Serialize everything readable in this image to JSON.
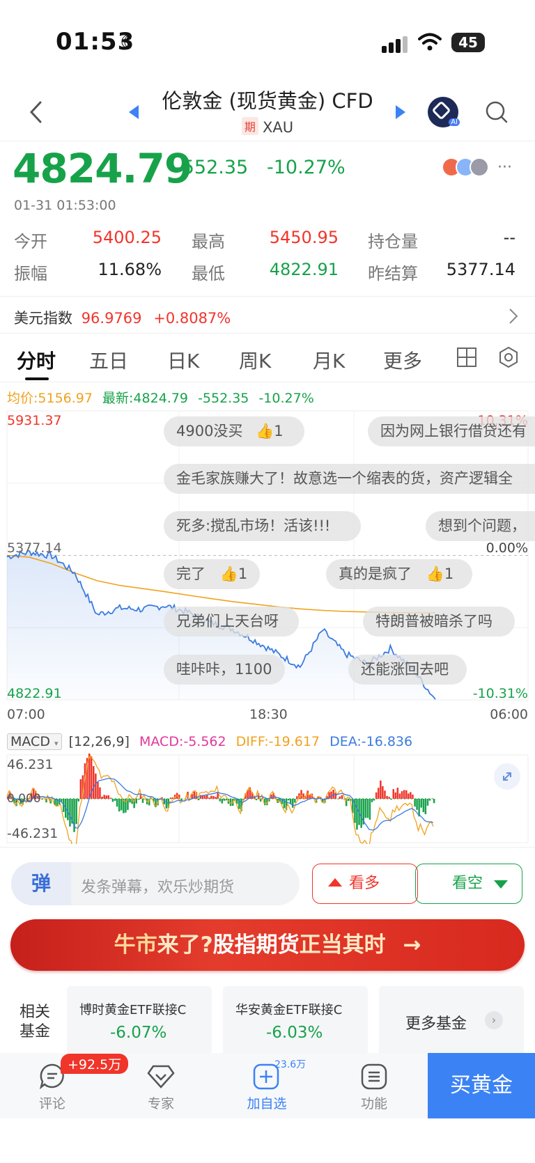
{
  "status_bar": {
    "time": "01:53",
    "battery": "45"
  },
  "header": {
    "title": "伦敦金 (现货黄金) CFD",
    "badge": "期",
    "symbol": "XAU",
    "ai_label": "AI"
  },
  "quote": {
    "price": "4824.79",
    "change": "-552.35",
    "change_pct": "-10.27%",
    "timestamp": "01-31 01:53:00",
    "more": "···",
    "stats": [
      {
        "label": "今开",
        "value": "5400.25",
        "color": "#f0352b"
      },
      {
        "label": "最高",
        "value": "5450.95",
        "color": "#f0352b"
      },
      {
        "label": "持仓量",
        "value": "--",
        "color": "#222222"
      },
      {
        "label": "振幅",
        "value": "11.68%",
        "color": "#222222"
      },
      {
        "label": "最低",
        "value": "4822.91",
        "color": "#17a24a"
      },
      {
        "label": "昨结算",
        "value": "5377.14",
        "color": "#222222"
      }
    ]
  },
  "usd_index": {
    "label": "美元指数",
    "value": "96.9769",
    "change": "+0.8087%"
  },
  "tabs": [
    "分时",
    "五日",
    "日K",
    "周K",
    "月K",
    "更多"
  ],
  "chart": {
    "avg_label": "均价:5156.97",
    "latest_label": "最新:4824.79",
    "latest_change": "-552.35",
    "latest_pct": "-10.27%",
    "y_top": "5931.37",
    "y_mid": "5377.14",
    "y_bottom": "4822.91",
    "pct_top": "10.31%",
    "pct_mid": "0.00%",
    "pct_bottom": "-10.31%",
    "x_labels": [
      "07:00",
      "18:30",
      "06:00"
    ],
    "colors": {
      "price_line": "#3a7be0",
      "avg_line": "#f0a21e"
    }
  },
  "chart_data": {
    "type": "line",
    "x": [
      "07:00",
      "08:00",
      "09:00",
      "10:00",
      "11:00",
      "12:00",
      "13:00",
      "14:00",
      "15:00",
      "16:00",
      "17:00",
      "18:00",
      "19:00",
      "20:00",
      "21:00",
      "22:00",
      "23:00",
      "00:00",
      "01:00",
      "01:53"
    ],
    "series": [
      {
        "name": "最新",
        "values": [
          5372,
          5390,
          5375,
          5310,
          5150,
          5175,
          5170,
          5185,
          5160,
          5120,
          5095,
          5050,
          5000,
          4950,
          5090,
          5000,
          4960,
          5020,
          4940,
          4824.79
        ]
      },
      {
        "name": "均价",
        "values": [
          5377,
          5370,
          5345,
          5310,
          5280,
          5262,
          5250,
          5238,
          5225,
          5212,
          5200,
          5190,
          5180,
          5172,
          5166,
          5162,
          5160,
          5158,
          5157,
          5156.97
        ]
      }
    ],
    "ylim": [
      4822.91,
      5931.37
    ]
  },
  "danmu_bubbles": [
    {
      "text": "4900没买",
      "likes": "1"
    },
    {
      "text": "因为网上银行借贷还有",
      "likes": ""
    },
    {
      "text": "金毛家族赚大了！故意选一个缩表的货，资产逻辑全",
      "likes": ""
    },
    {
      "text": "死多:搅乱市场！活该!!!",
      "likes": ""
    },
    {
      "text": "想到个问题，",
      "likes": ""
    },
    {
      "text": "完了",
      "likes": "1"
    },
    {
      "text": "真的是疯了",
      "likes": "1"
    },
    {
      "text": "兄弟们上天台呀",
      "likes": ""
    },
    {
      "text": "特朗普被暗杀了吗",
      "likes": ""
    },
    {
      "text": "哇咔咔，1100",
      "likes": ""
    },
    {
      "text": "还能涨回去吧",
      "likes": ""
    }
  ],
  "macd": {
    "name": "MACD",
    "params": "[12,26,9]",
    "macd": "MACD:-5.562",
    "diff": "DIFF:-19.617",
    "dea": "DEA:-16.836",
    "y_top": "46.231",
    "y_mid": "0.000",
    "y_bottom": "-46.231"
  },
  "danmu_input": {
    "icon_text": "弹",
    "placeholder": "发条弹幕，欢乐炒期货"
  },
  "sentiment": {
    "bull": "看多",
    "bear": "看空"
  },
  "banner": {
    "part1": "牛市",
    "part2": "来了?",
    "part3": "股指期货",
    "part4": "正当其时",
    "arrow": "→"
  },
  "funds": {
    "label": "相关基金",
    "items": [
      {
        "name": "博时黄金ETF联接C",
        "pct": "-6.07%"
      },
      {
        "name": "华安黄金ETF联接C",
        "pct": "-6.03%"
      }
    ],
    "more": "更多基金"
  },
  "bottom_nav": {
    "items": [
      {
        "label": "评论",
        "badge": "+92.5万"
      },
      {
        "label": "专家",
        "badge": ""
      },
      {
        "label": "加自选",
        "badge": "23.6万"
      },
      {
        "label": "功能",
        "badge": ""
      }
    ],
    "buy": "买黄金"
  }
}
